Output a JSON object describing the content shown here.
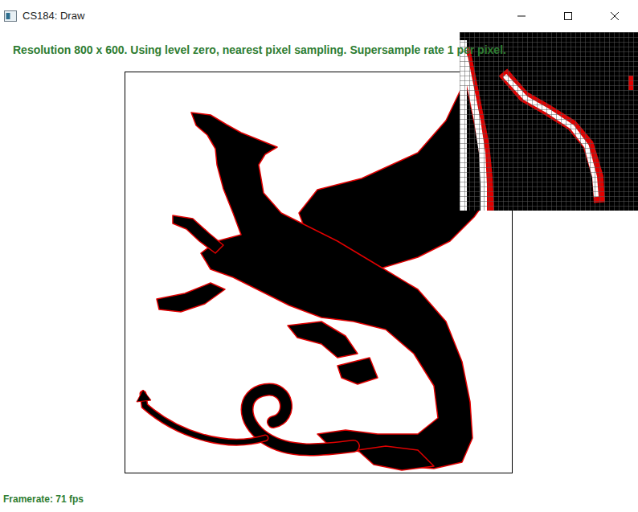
{
  "window": {
    "title": "CS184: Draw"
  },
  "overlay": {
    "info": "Resolution 800 x 600. Using level zero, nearest pixel sampling. Supersample rate 1 per pixel.",
    "framerate": "Framerate: 71 fps"
  }
}
